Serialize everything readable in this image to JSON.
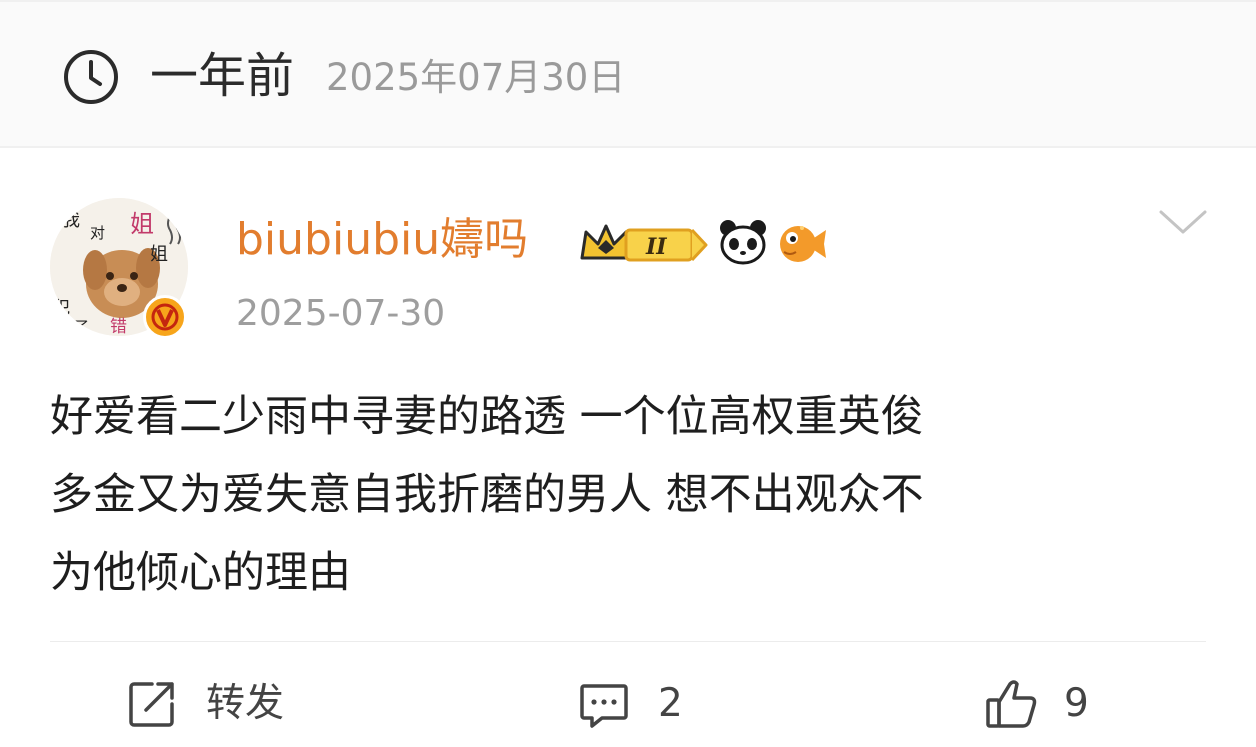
{
  "header": {
    "relative_time": "一年前",
    "date": "2025年07月30日"
  },
  "post": {
    "username": "biubiubiu嬦吗",
    "date": "2025-07-30",
    "avatar_text": [
      "我",
      "对",
      "姐",
      "姐",
      "犯",
      "了",
      "错"
    ],
    "badge_level": "II",
    "content_lines": [
      "好爱看二少雨中寻妻的路透 一个位高权重英俊",
      "多金又为爱失意自我折磨的男人 想不出观众不",
      "为他倾心的理由"
    ]
  },
  "actions": {
    "repost_label": "转发",
    "comment_count": "2",
    "like_count": "9"
  },
  "colors": {
    "username": "#e27d2e",
    "verified": "#f7a51b",
    "text": "#1e1e1e",
    "muted": "#9e9e9e"
  },
  "icons": [
    "clock-icon",
    "crown-badge-icon",
    "panda-icon",
    "pufferfish-icon",
    "chevron-down-icon",
    "verified-v-icon",
    "repost-icon",
    "comment-icon",
    "like-icon"
  ]
}
